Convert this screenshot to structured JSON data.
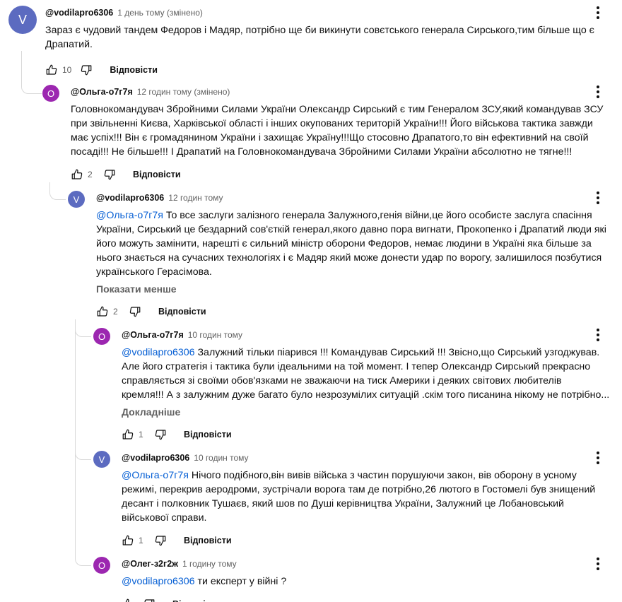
{
  "labels": {
    "reply": "Відповісти"
  },
  "colors": {
    "avatar_v": "#5c6bc0",
    "avatar_o": "#9c27b0",
    "mention": "#065fd4"
  },
  "comments": [
    {
      "avatar_letter": "V",
      "author": "@vodilapro6306",
      "time": "1 день тому (змінено)",
      "text": "Зараз є чудовий тандем Федоров і Мадяр, потрібно ще би викинути совєтського генерала Сирського,тим більше що є Драпатий.",
      "likes": "10"
    },
    {
      "avatar_letter": "О",
      "author": "@Ольга-о7г7я",
      "time": "12 годин тому (змінено)",
      "text": "Головнокомандувач Збройними Силами України Олександр Сирський є тим Генералом ЗСУ,який командував ЗСУ при звільненні Києва, Харківської області і інших окупованих територій України!!! Його військова тактика завжди має успіх!!! Він є громадянином України і захищає Україну!!!Що стосовно Драпатого,то він ефективний на своїй посаді!!! Не більше!!! І Драпатий на Головнокомандувача Збройними Силами України абсолютно не тягне!!!",
      "likes": "2"
    },
    {
      "avatar_letter": "V",
      "author": "@vodilapro6306",
      "time": "12 годин тому",
      "mention": "@Ольга-о7г7я",
      "text": " То все заслуги залізного генерала Залужного,генія війни,це його особисте заслуга спасіння України, Сирський це бездарний сов'єткій генерал,якого давно пора вигнати, Прокопенко і Драпатий люди які його можуть замінити, нарешті є сильний міністр оборони Федоров, немає людини в Україні яка більше за нього знається на сучасних технологіях і є Мадяр який може донести удар по ворогу, залишилося позбутися українського Герасімова.",
      "show_less": "Показати менше",
      "likes": "2"
    },
    {
      "avatar_letter": "О",
      "author": "@Ольга-о7г7я",
      "time": "10 годин тому",
      "mention": "@vodilapro6306",
      "text_lines": [
        " Залужний тільки піарився !!! Командував Сирський !!! Звісно,що Сирський узгоджував.",
        "Але його стратегія і тактика були ідеальними на той момент. І тепер Олександр Сирський прекрасно",
        "справляється зі своїми обов'язками не зважаючи на тиск Америки і деяких світових любителів",
        "кремля!!! А з залужним дуже багато було незрозумілих ситуацій .скім того писанина нікому не потрібно..."
      ],
      "read_more": "Докладніше",
      "likes": "1"
    },
    {
      "avatar_letter": "V",
      "author": "@vodilapro6306",
      "time": "10 годин тому",
      "mention": "@Ольга-о7г7я",
      "text": " Нічого подібного,він вивів війська з частин порушуючи закон, вів оборону в усному режимі, перекрив аеродроми, зустрічали ворога там де потрібно,26 лютого в Гостомелі був знищений десант і полковник Тушаєв, який шов по Душі керівництва України, Залужний це Лобановський військової справи.",
      "likes": "1"
    },
    {
      "avatar_letter": "О",
      "author": "@Олег-з2г2ж",
      "time": "1 годину тому",
      "mention": "@vodilapro6306",
      "text": " ти експерт у війні ?",
      "likes": ""
    }
  ]
}
